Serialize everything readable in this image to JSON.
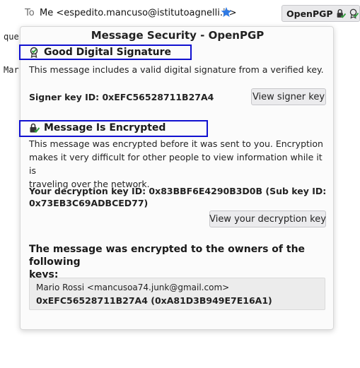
{
  "header": {
    "to_label": "To",
    "recipient": "Me <espedito.mancuso@istitutoagnelli.it>",
    "openpgp_label": "OpenPGP",
    "star_color": "#2f7ae5"
  },
  "background_text": {
    "line1": "que",
    "line2": "Mar"
  },
  "popup": {
    "title": "Message Security - OpenPGP",
    "signature": {
      "heading": "Good Digital Signature",
      "description": "This message includes a valid digital signature from a verified key.",
      "signer_key": "Signer key ID: 0xEFC56528711B27A4",
      "button": "View signer key"
    },
    "encryption": {
      "heading": "Message Is Encrypted",
      "description_lines": [
        "This message was encrypted before it was sent to you. Encryption",
        "makes it very difficult for other people to view information while it is",
        "traveling over the network."
      ],
      "decryption_key_lines": [
        "Your decryption key ID: 0x83BBF6E4290B3D0B (Sub key ID:",
        "0x73EB3C69ADBCED77)"
      ],
      "button": "View your decryption key"
    },
    "recipients": {
      "heading_lines": [
        "The message was encrypted to the owners of the following",
        "keys:"
      ],
      "keys": [
        {
          "owner": "Mario Rossi <mancusoa74.junk@gmail.com>",
          "key_id": "0xEFC56528711B27A4 (0xA81D3B949E7E16A1)"
        }
      ]
    }
  },
  "colors": {
    "highlight_box": "#1010d0",
    "check_green": "#2e9d3a",
    "icon_dark": "#333333"
  },
  "icons": {
    "signature": "seal-check-icon",
    "encryption": "lock-check-icon"
  }
}
